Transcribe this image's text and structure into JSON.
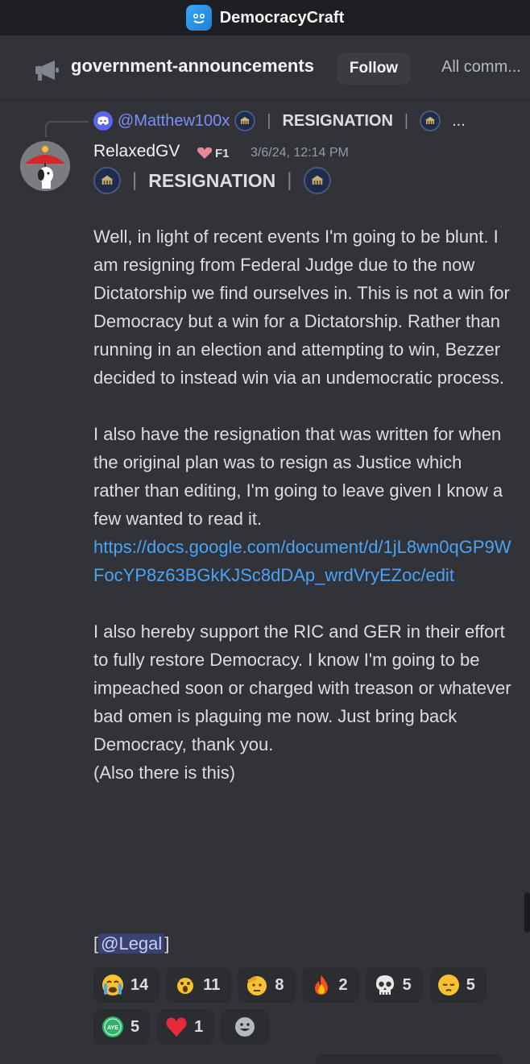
{
  "server": {
    "name": "DemocracyCraft"
  },
  "channel": {
    "name": "government-announcements",
    "follow_label": "Follow",
    "all_communities_label": "All comm..."
  },
  "reply": {
    "user": "@Matthew100x",
    "title": "RESIGNATION",
    "overflow": "..."
  },
  "message": {
    "author": "RelaxedGV",
    "tag": "F1",
    "timestamp": "3/6/24, 12:14 PM",
    "title": "RESIGNATION",
    "paragraph_1": "Well, in light of recent events I'm going to be blunt. I am resigning from Federal Judge due to the now Dictatorship we find ourselves in. This is not a win for Democracy but a win for a Dictatorship. Rather than running in an election and attempting to win, Bezzer decided to instead win via an undemocratic process.",
    "paragraph_2": "I also have the resignation that was written for when the original plan was to resign as Justice which rather than editing, I'm going to leave given I know a few wanted to read it.",
    "link": "https://docs.google.com/document/d/1jL8wn0qGP9WFocYP8z63BGkKJSc8dDAp_wrdVryEZoc/edit",
    "paragraph_3": "I also hereby support the RIC and GER in their effort to fully restore Democracy. I know I'm going to be impeached soon or charged with treason or whatever bad omen is plaguing me now. Just bring back Democracy, thank you.",
    "paragraph_4": "(Also there is this)",
    "mention_open": "[",
    "mention": "@Legal",
    "mention_close": "]"
  },
  "reactions": [
    {
      "icon": "crying-face-icon",
      "count": "14"
    },
    {
      "icon": "screaming-face-icon",
      "count": "11"
    },
    {
      "icon": "saluting-face-icon",
      "count": "8"
    },
    {
      "icon": "fire-icon",
      "count": "2"
    },
    {
      "icon": "skull-icon",
      "count": "5"
    },
    {
      "icon": "pensive-face-icon",
      "count": "5"
    },
    {
      "icon": "aye-badge-icon",
      "label": "AYE",
      "count": "5"
    },
    {
      "icon": "heart-icon",
      "count": "1"
    }
  ],
  "colors": {
    "background": "#313338",
    "link": "#4aa3f7",
    "mention_bg": "#3c4270",
    "reply_user": "#7d8ef8"
  }
}
